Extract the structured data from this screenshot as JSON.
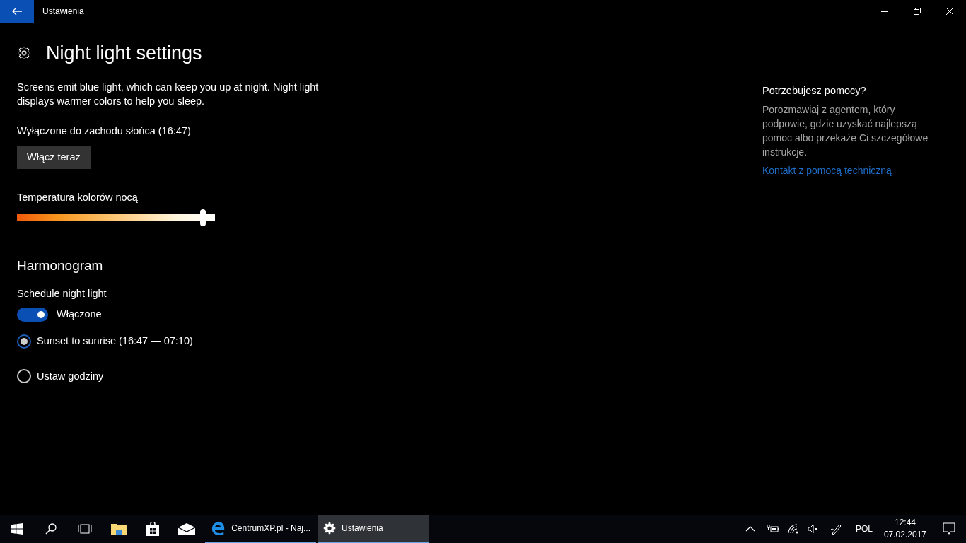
{
  "window": {
    "title": "Ustawienia"
  },
  "page": {
    "title": "Night light settings",
    "description": "Screens emit blue light, which can keep you up at night. Night light displays warmer colors to help you sleep.",
    "status": "Wyłączone do zachodu słońca (16:47)",
    "button": "Włącz teraz"
  },
  "temperature": {
    "label": "Temperatura kolorów nocą",
    "level": 0.94
  },
  "schedule": {
    "heading": "Harmonogram",
    "label": "Schedule night light",
    "toggle": {
      "on": true,
      "label": "Włączone"
    },
    "options": [
      {
        "label": "Sunset to sunrise (16:47 — 07:10)",
        "selected": true
      },
      {
        "label": "Ustaw godziny",
        "selected": false
      }
    ]
  },
  "help": {
    "heading": "Potrzebujesz pomocy?",
    "text": "Porozmawiaj z agentem, który podpowie, gdzie uzyskać najlepszą pomoc albo przekaże Ci szczegółowe instrukcje.",
    "link": "Kontakt z pomocą techniczną"
  },
  "taskbar": {
    "apps": [
      {
        "kind": "edge",
        "label": "CentrumXP.pl - Naj...",
        "selected": false
      },
      {
        "kind": "settings",
        "label": "Ustawienia",
        "selected": true
      }
    ],
    "language": "POL",
    "time": "12:44",
    "date": "07.02.2017"
  }
}
